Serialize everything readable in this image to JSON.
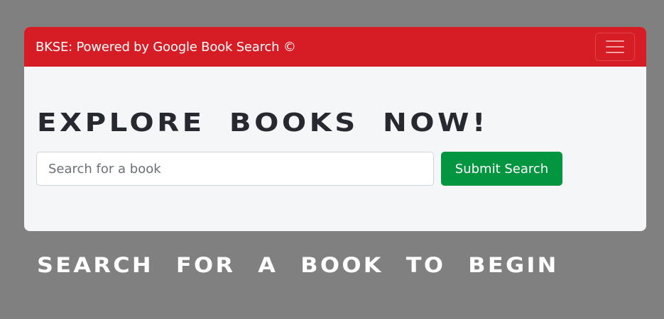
{
  "navbar": {
    "brand": "BKSE: Powered by Google Book Search ©",
    "toggler_icon": "hamburger-menu-icon"
  },
  "hero": {
    "title": "EXPLORE BOOKS NOW!"
  },
  "search": {
    "value": "",
    "placeholder": "Search for a book",
    "submit_label": "Submit Search"
  },
  "results": {
    "empty_message": "SEARCH FOR A BOOK TO BEGIN"
  },
  "colors": {
    "page_background": "#808080",
    "navbar": "#d61c24",
    "card": "#f5f6f8",
    "submit_button": "#03953f",
    "heading_text": "#262a30"
  }
}
